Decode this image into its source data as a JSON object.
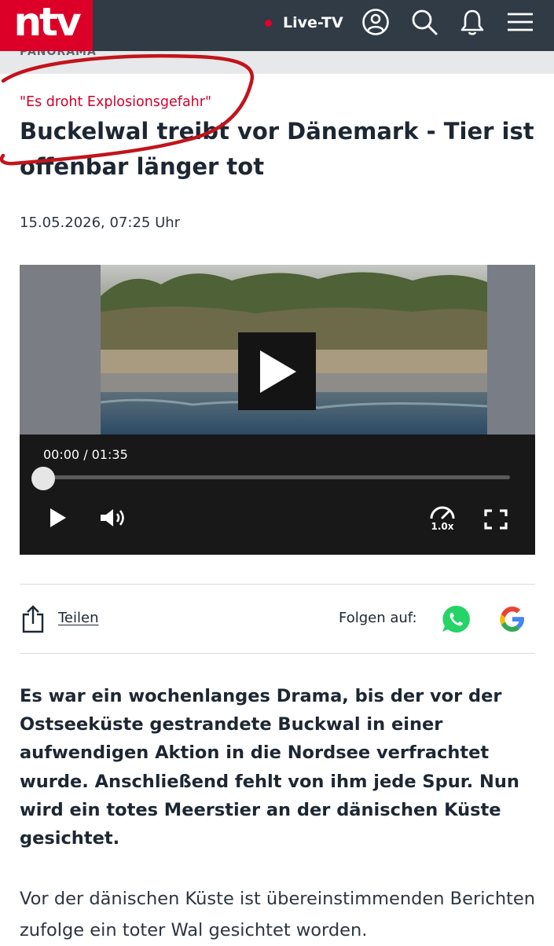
{
  "header": {
    "logo_text": "ntv",
    "live_label": "Live-TV",
    "icons": [
      "user-account-icon",
      "search-icon",
      "bell-icon",
      "menu-icon"
    ],
    "colors": {
      "bar": "#303b46",
      "brand_red": "#dc0028"
    }
  },
  "section": {
    "label": "PANORAMA"
  },
  "article": {
    "kicker": "\"Es droht Explosionsgefahr\"",
    "title": "Buckelwal treibt vor Dänemark - Tier ist offenbar länger tot",
    "date": "15.05.2026, 07:25 Uhr",
    "lead": "Es war ein wochenlanges Drama, bis der vor der Ostseeküste gestrandete Buckwal in einer aufwendigen Aktion in die Nordsee verfrachtet wurde. Anschließend fehlt von ihm jede Spur. Nun wird ein totes Meerstier an der dänischen Küste gesichtet.",
    "body": "Vor der dänischen Küste ist übereinstimmenden Berichten zufolge ein toter Wal gesichtet worden."
  },
  "video": {
    "time_display": "00:00 / 01:35",
    "progress": 0,
    "speed_label": "1.0x",
    "icons": [
      "play-icon",
      "volume-icon",
      "playback-speed-icon",
      "fullscreen-icon"
    ]
  },
  "share": {
    "share_label": "Teilen",
    "follow_label": "Folgen auf:",
    "icons": [
      "share-icon",
      "whatsapp-icon",
      "google-icon"
    ]
  }
}
